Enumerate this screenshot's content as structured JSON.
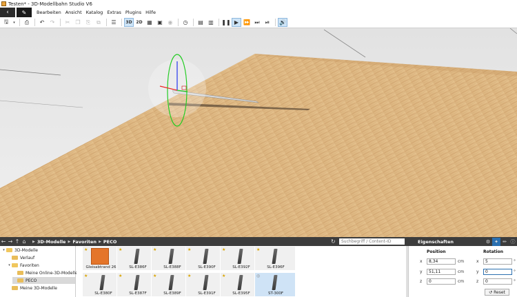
{
  "window": {
    "title": "Testen* - 3D-Modellbahn Studio V6"
  },
  "menu": {
    "back_icon": "chevron-left-icon",
    "edit_icon": "pencil-icon",
    "items": [
      "Bearbeiten",
      "Ansicht",
      "Katalog",
      "Extras",
      "Plugins",
      "Hilfe"
    ]
  },
  "toolbar": {
    "mode_3d": "3D",
    "mode_2d": "2D"
  },
  "catalog": {
    "breadcrumb": [
      "3D-Modelle",
      "Favoriten",
      "PECO"
    ],
    "search_placeholder": "Suchbegriff / Content-ID",
    "tree": [
      {
        "label": "3D-Modelle",
        "level": 0,
        "open": true
      },
      {
        "label": "Verlauf",
        "level": 1
      },
      {
        "label": "Favoriten",
        "level": 1,
        "open": true
      },
      {
        "label": "Meine Online-3D-Modelle",
        "level": 2
      },
      {
        "label": "PECO",
        "level": 2,
        "selected": true
      },
      {
        "label": "Meine 3D-Modelle",
        "level": 1
      }
    ],
    "models_row1": [
      "Gleisabtrand 26,...",
      "SL-E386F",
      "SL-E388F",
      "SL-E390F",
      "SL-E392F",
      "SL-E396F"
    ],
    "models_row2": [
      "SL-E380F",
      "SL-E387F",
      "SL-E389F",
      "SL-E391F",
      "SL-E395F",
      "ST-300F"
    ]
  },
  "properties": {
    "title": "Eigenschaften",
    "position_label": "Position",
    "rotation_label": "Rotation",
    "axes": [
      "x",
      "y",
      "z"
    ],
    "position": [
      "8,34",
      "51,11",
      "0"
    ],
    "rotation": [
      "5",
      "0",
      "0"
    ],
    "unit": "cm",
    "reset_label": "Reset"
  }
}
